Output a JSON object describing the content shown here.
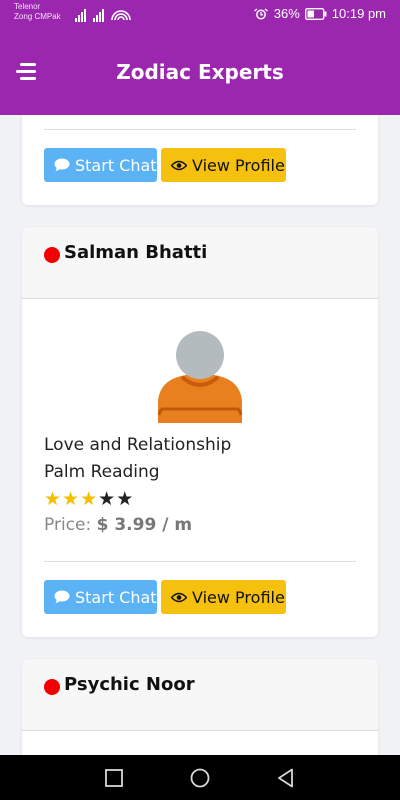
{
  "status_bar": {
    "carrier_line1": "Telenor",
    "carrier_line2": "Zong CMPak",
    "battery_percent": "36%",
    "time": "10:19 pm"
  },
  "header": {
    "title": "Zodiac Experts",
    "menu_icon": "hamburger-menu-icon"
  },
  "cards": [
    {
      "partial": true,
      "start_chat_label": "Start Chat",
      "view_profile_label": "View Profile"
    },
    {
      "name": "Salman Bhatti",
      "status_color": "#f30000",
      "specialties": [
        "Love and Relationship",
        "Palm Reading"
      ],
      "rating": 3,
      "rating_max": 5,
      "price_label": "Price:",
      "price_value": "$ 3.99 / m",
      "start_chat_label": "Start Chat",
      "view_profile_label": "View Profile"
    },
    {
      "name": "Psychic Noor",
      "status_color": "#f30000"
    }
  ],
  "colors": {
    "primary": "#9b27af",
    "chat_button": "#5bb3f5",
    "profile_button": "#f6c10e",
    "star_filled": "#f3c000",
    "status_offline": "#f30000"
  },
  "nav_bar": {
    "icons": [
      "recent-apps-icon",
      "home-icon",
      "back-icon"
    ]
  }
}
